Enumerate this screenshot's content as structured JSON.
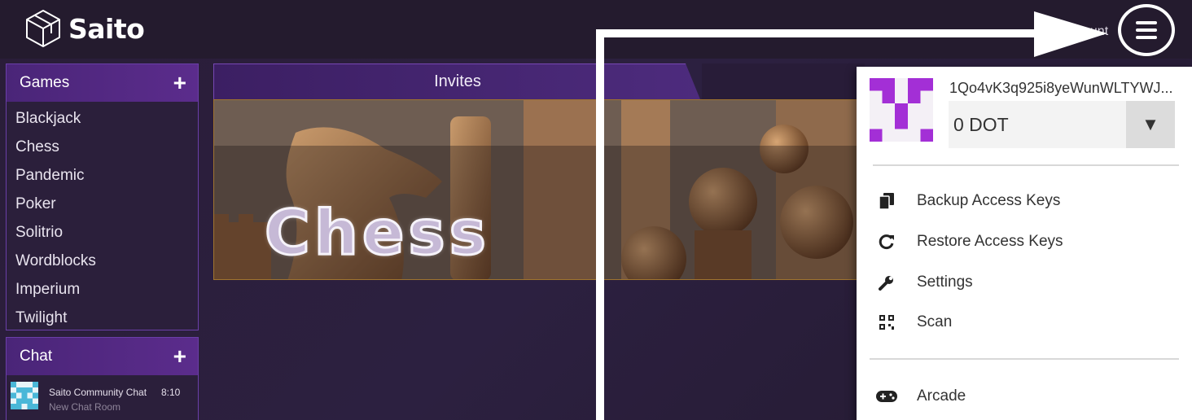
{
  "header": {
    "brand": "Saito",
    "account_partial": "ount"
  },
  "sidebar": {
    "games": {
      "title": "Games",
      "add": "+",
      "items": [
        "Blackjack",
        "Chess",
        "Pandemic",
        "Poker",
        "Solitrio",
        "Wordblocks",
        "Imperium",
        "Twilight"
      ]
    },
    "chat": {
      "title": "Chat",
      "add": "+",
      "items": [
        {
          "name": "Saito Community Chat",
          "time": "8:10",
          "subtitle": "New Chat Room"
        }
      ]
    }
  },
  "main": {
    "tabs": [
      {
        "label": "Invites"
      }
    ],
    "banner": {
      "title": "Chess"
    }
  },
  "menu": {
    "public_key": "1Qo4vK3q925i8yeWunWLTYWJ...",
    "balance": "0 DOT",
    "dropdown_glyph": "▼",
    "items": [
      {
        "label": "Backup Access Keys",
        "icon": "copy-icon"
      },
      {
        "label": "Restore Access Keys",
        "icon": "restore-icon"
      },
      {
        "label": "Settings",
        "icon": "wrench-icon"
      },
      {
        "label": "Scan",
        "icon": "qr-code-icon"
      },
      {
        "label": "Arcade",
        "icon": "gamepad-icon"
      }
    ]
  },
  "colors": {
    "accent_purple": "#5b2c8c",
    "identicon": "#a32fd6"
  }
}
